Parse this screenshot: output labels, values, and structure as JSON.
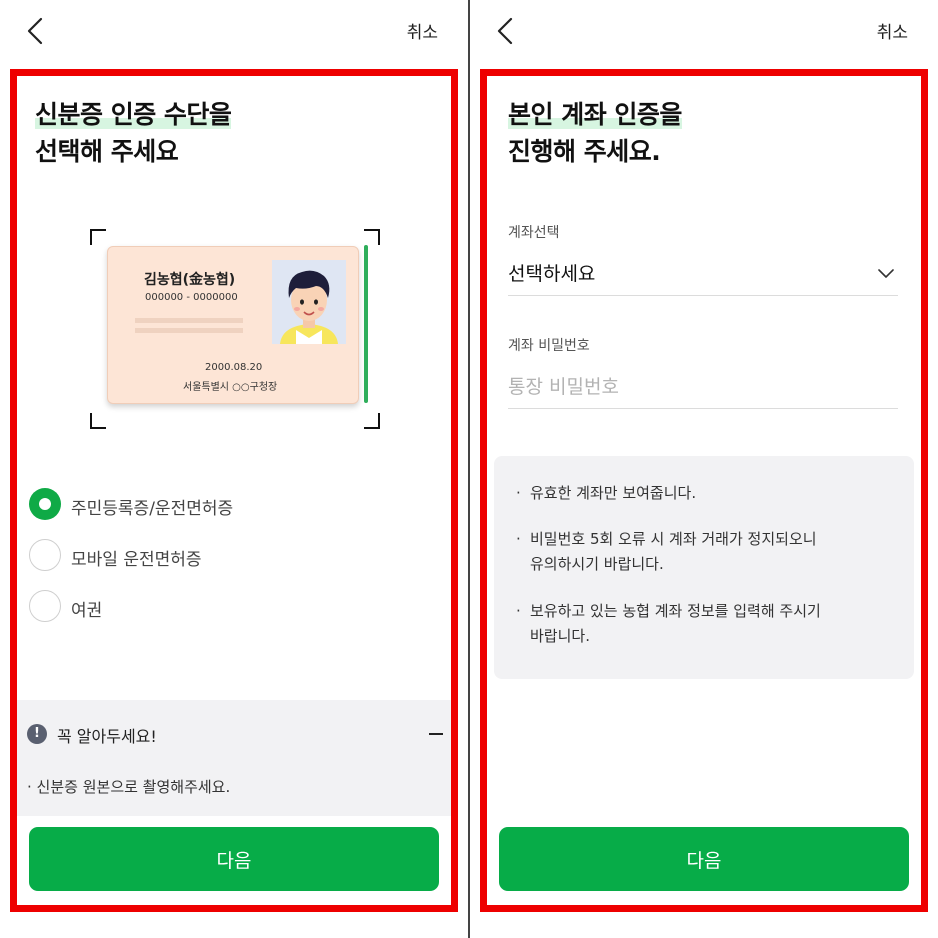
{
  "left_screen": {
    "header": {
      "cancel_label": "취소"
    },
    "title": {
      "highlight": "신분증 인증 수단을",
      "line2": "선택해 주세요"
    },
    "id_card": {
      "name": "김농협(金농협)",
      "number": "000000 - 0000000",
      "issue_date": "2000.08.20",
      "issuer": "서울특별시 ○○구청장"
    },
    "options": [
      {
        "label": "주민등록증/운전면허증",
        "selected": true
      },
      {
        "label": "모바일 운전면허증",
        "selected": false
      },
      {
        "label": "여권",
        "selected": false
      }
    ],
    "notice": {
      "icon": "exclamation-icon",
      "title": "꼭 알아두세요!",
      "items": [
        "신분증 원본으로 촬영해주세요."
      ]
    },
    "next_label": "다음"
  },
  "right_screen": {
    "header": {
      "cancel_label": "취소"
    },
    "title": {
      "highlight": "본인 계좌 인증을",
      "line2": "진행해 주세요."
    },
    "account": {
      "label": "계좌선택",
      "value": "선택하세요"
    },
    "password": {
      "label": "계좌 비밀번호",
      "placeholder": "통장 비밀번호"
    },
    "info": [
      {
        "lines": [
          "유효한 계좌만 보여줍니다."
        ]
      },
      {
        "lines": [
          "비밀번호 5회 오류 시 계좌 거래가 정지되오니",
          "유의하시기 바랍니다."
        ]
      },
      {
        "lines": [
          "보유하고 있는 농협 계좌 정보를 입력해 주시기",
          "바랍니다."
        ]
      }
    ],
    "next_label": "다음"
  },
  "colors": {
    "accent": "#07ac48",
    "frame": "#ee0000",
    "highlight": "#d7f5e1",
    "notice_bg": "#f2f2f4"
  }
}
